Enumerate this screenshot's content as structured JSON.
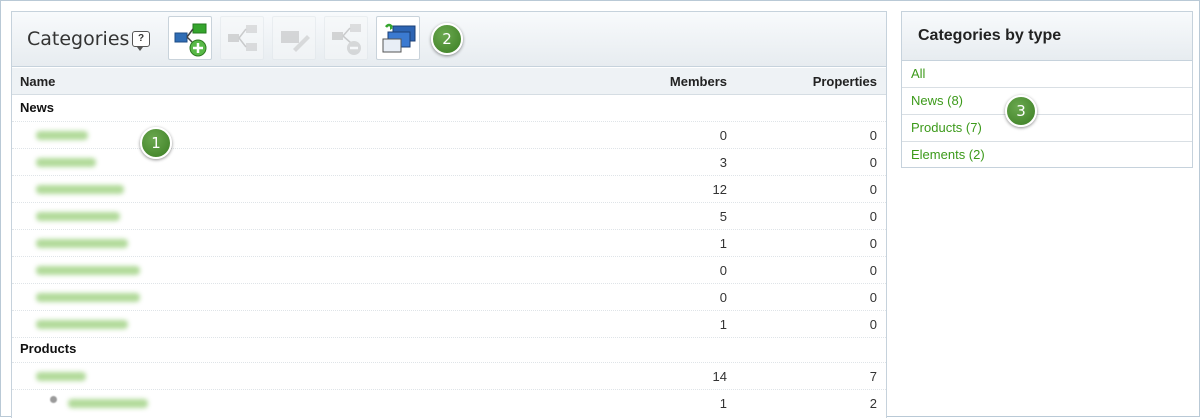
{
  "categories_panel": {
    "title": "Categories",
    "help_icon": "?",
    "toolbar": [
      {
        "name": "add-category-icon",
        "enabled": true
      },
      {
        "name": "add-subcategory-icon",
        "enabled": false
      },
      {
        "name": "edit-category-icon",
        "enabled": false
      },
      {
        "name": "delete-category-icon",
        "enabled": false
      },
      {
        "name": "category-windows-icon",
        "enabled": true
      }
    ],
    "columns": {
      "name": "Name",
      "members": "Members",
      "properties": "Properties"
    },
    "groups": [
      {
        "label": "News",
        "rows": [
          {
            "members": "0",
            "properties": "0"
          },
          {
            "members": "3",
            "properties": "0"
          },
          {
            "members": "12",
            "properties": "0"
          },
          {
            "members": "5",
            "properties": "0"
          },
          {
            "members": "1",
            "properties": "0"
          },
          {
            "members": "0",
            "properties": "0"
          },
          {
            "members": "0",
            "properties": "0"
          },
          {
            "members": "1",
            "properties": "0"
          }
        ]
      },
      {
        "label": "Products",
        "rows": [
          {
            "members": "14",
            "properties": "7"
          },
          {
            "members": "1",
            "properties": "2"
          }
        ]
      }
    ]
  },
  "callouts": [
    "1",
    "2",
    "3"
  ],
  "categories_by_type": {
    "title": "Categories by type",
    "items": [
      "All",
      "News (8)",
      "Products (7)",
      "Elements (2)"
    ]
  },
  "colors": {
    "link": "#3c9a1a",
    "badge": "#4e8f33",
    "blurred_name": "#a9d68f"
  }
}
